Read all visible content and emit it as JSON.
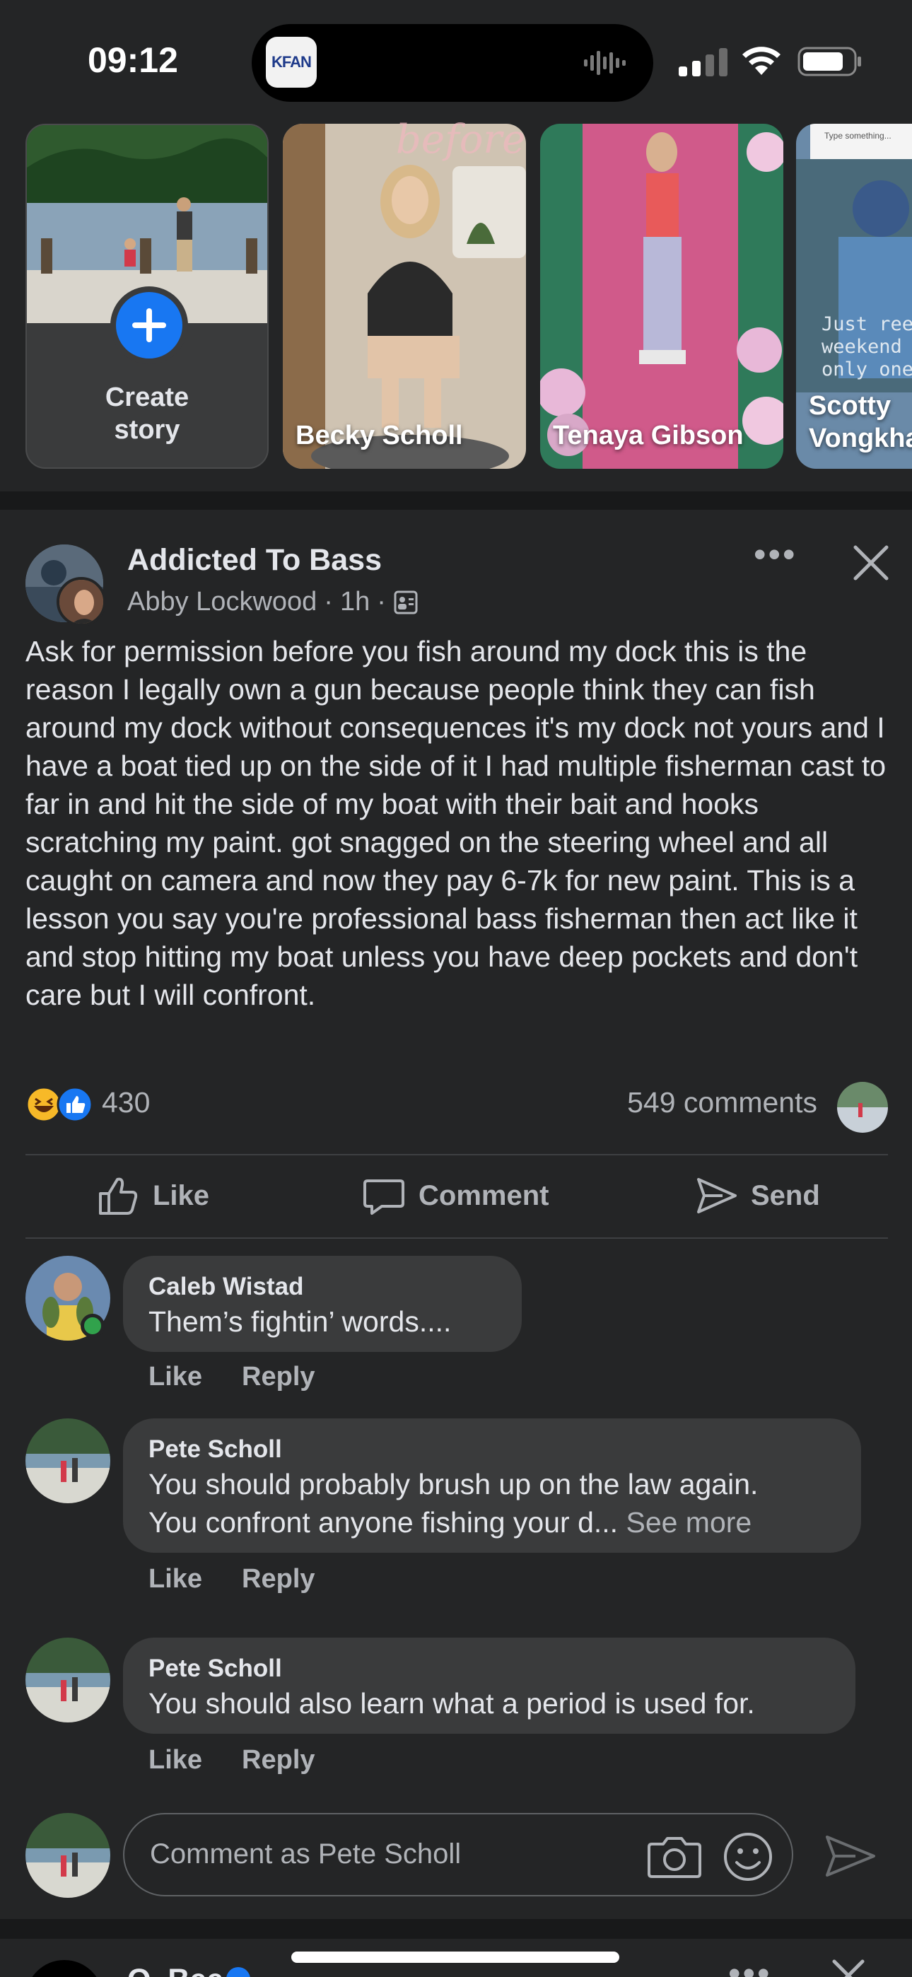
{
  "status_bar": {
    "time": "09:12",
    "island_app_label": "KFAN",
    "icons": [
      "waveform-icon",
      "cellular-signal-icon",
      "wifi-icon",
      "battery-icon"
    ]
  },
  "stories": {
    "create_label_line1": "Create",
    "create_label_line2": "story",
    "items": [
      {
        "name": "Becky Scholl"
      },
      {
        "name": "Tenaya Gibson"
      },
      {
        "name_line1": "Scotty",
        "name_line2": "Vongkha"
      }
    ],
    "overlay_text_1": "before",
    "overlay_text_2": "Just reel weekend only one",
    "overlay_text_3": "Type something..."
  },
  "post": {
    "group_name": "Addicted To Bass",
    "author": "Abby Lockwood",
    "time": "1h",
    "separator": "·",
    "more_icon": "•••",
    "body": "Ask for permission before you fish around my dock this is the reason I legally own a gun because people think they can fish around my dock without consequences it's my dock not yours and I have a boat tied up on the side of it I had multiple fisherman cast to far in and hit the side of my boat with their bait and hooks scratching my paint. got snagged on the steering wheel and all caught on camera and now they pay 6-7k for new paint. This is a lesson you say you're professional bass fisherman then act like it and stop hitting my boat unless you have deep pockets and don't care but I will confront.",
    "reaction_count": "430",
    "comment_count": "549 comments",
    "actions": {
      "like": "Like",
      "comment": "Comment",
      "send": "Send"
    }
  },
  "comments": [
    {
      "name": "Caleb Wistad",
      "text": "Them’s fightin’ words....",
      "like": "Like",
      "reply": "Reply",
      "online": true
    },
    {
      "name": "Pete Scholl",
      "text_line1": "You should probably brush up on the law again.",
      "text_line2": "You confront anyone fishing your d...",
      "see_more": "See more",
      "like": "Like",
      "reply": "Reply"
    },
    {
      "name": "Pete Scholl",
      "text": "You should also learn what a period is used for.",
      "like": "Like",
      "reply": "Reply"
    }
  ],
  "composer": {
    "placeholder": "Comment as Pete Scholl"
  },
  "next_post": {
    "name": "O. Bee",
    "more_icon": "•••"
  },
  "colors": {
    "background": "#242526",
    "separator": "#18191a",
    "bubble": "#3a3b3c",
    "accent": "#1877f2",
    "online": "#31a24c",
    "text_primary": "#e4e6eb",
    "text_secondary": "#b0b3b8"
  }
}
